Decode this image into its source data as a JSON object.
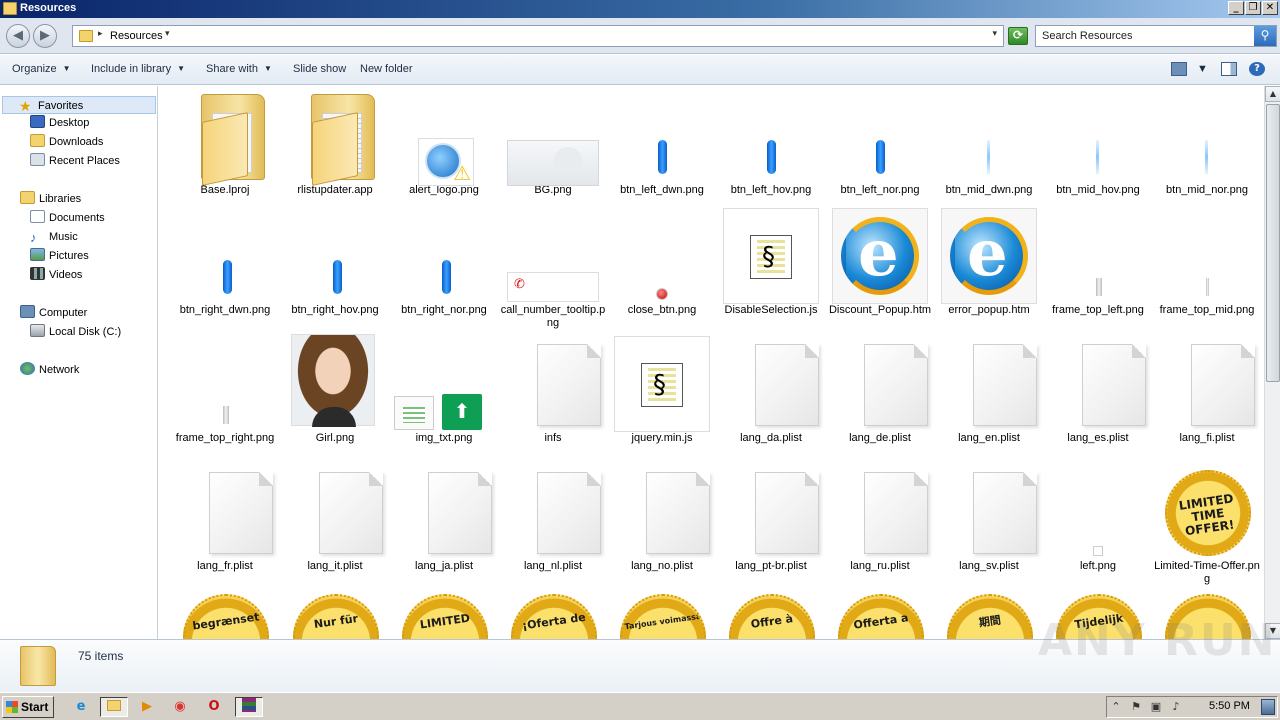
{
  "window": {
    "title": "Resources"
  },
  "address": {
    "crumb": "Resources",
    "search_placeholder": "Search Resources"
  },
  "toolbar": {
    "organize": "Organize",
    "include_in_library": "Include in library",
    "share_with": "Share with",
    "slide_show": "Slide show",
    "new_folder": "New folder"
  },
  "nav": {
    "favorites": "Favorites",
    "desktop": "Desktop",
    "downloads": "Downloads",
    "recent_places": "Recent Places",
    "libraries": "Libraries",
    "documents": "Documents",
    "music": "Music",
    "pictures": "Pictures",
    "videos": "Videos",
    "computer": "Computer",
    "local_disk": "Local Disk (C:)",
    "network": "Network"
  },
  "files": [
    {
      "name": "Base.lproj",
      "icon": "folder-empty-icon"
    },
    {
      "name": "rlistupdater.app",
      "icon": "folder-with-files-icon"
    },
    {
      "name": "alert_logo.png",
      "icon": "alert-logo-thumbnail"
    },
    {
      "name": "BG.png",
      "icon": "bg-thumbnail"
    },
    {
      "name": "btn_left_dwn.png",
      "icon": "blue-pill-thumbnail"
    },
    {
      "name": "btn_left_hov.png",
      "icon": "blue-pill-thumbnail"
    },
    {
      "name": "btn_left_nor.png",
      "icon": "blue-pill-thumbnail"
    },
    {
      "name": "btn_mid_dwn.png",
      "icon": "thin-line-thumbnail"
    },
    {
      "name": "btn_mid_hov.png",
      "icon": "thin-line-thumbnail"
    },
    {
      "name": "btn_mid_nor.png",
      "icon": "thin-line-thumbnail"
    },
    {
      "name": "btn_right_dwn.png",
      "icon": "blue-pill-thumbnail"
    },
    {
      "name": "btn_right_hov.png",
      "icon": "blue-pill-thumbnail"
    },
    {
      "name": "btn_right_nor.png",
      "icon": "blue-pill-thumbnail"
    },
    {
      "name": "call_number_tooltip.png",
      "icon": "phone-tooltip-thumbnail"
    },
    {
      "name": "close_btn.png",
      "icon": "red-dot-thumbnail"
    },
    {
      "name": "DisableSelection.js",
      "icon": "script-icon"
    },
    {
      "name": "Discount_Popup.htm",
      "icon": "ie-icon"
    },
    {
      "name": "error_popup.htm",
      "icon": "ie-icon"
    },
    {
      "name": "frame_top_left.png",
      "icon": "gray-line-thumbnail"
    },
    {
      "name": "frame_top_mid.png",
      "icon": "gray-line-thumbnail"
    },
    {
      "name": "frame_top_right.png",
      "icon": "gray-line-thumbnail"
    },
    {
      "name": "Girl.png",
      "icon": "girl-photo-thumbnail"
    },
    {
      "name": "img_txt.png",
      "icon": "img-txt-thumbnail"
    },
    {
      "name": "infs",
      "icon": "blank-file-icon"
    },
    {
      "name": "jquery.min.js",
      "icon": "script-icon"
    },
    {
      "name": "lang_da.plist",
      "icon": "blank-file-icon"
    },
    {
      "name": "lang_de.plist",
      "icon": "blank-file-icon"
    },
    {
      "name": "lang_en.plist",
      "icon": "blank-file-icon"
    },
    {
      "name": "lang_es.plist",
      "icon": "blank-file-icon"
    },
    {
      "name": "lang_fi.plist",
      "icon": "blank-file-icon"
    },
    {
      "name": "lang_fr.plist",
      "icon": "blank-file-icon"
    },
    {
      "name": "lang_it.plist",
      "icon": "blank-file-icon"
    },
    {
      "name": "lang_ja.plist",
      "icon": "blank-file-icon"
    },
    {
      "name": "lang_nl.plist",
      "icon": "blank-file-icon"
    },
    {
      "name": "lang_no.plist",
      "icon": "blank-file-icon"
    },
    {
      "name": "lang_pt-br.plist",
      "icon": "blank-file-icon"
    },
    {
      "name": "lang_ru.plist",
      "icon": "blank-file-icon"
    },
    {
      "name": "lang_sv.plist",
      "icon": "blank-file-icon"
    },
    {
      "name": "left.png",
      "icon": "tiny-image-thumbnail"
    },
    {
      "name": "Limited-Time-Offer.png",
      "icon": "offer-badge-thumbnail",
      "badge_text": "LIMITED TIME OFFER!"
    }
  ],
  "partial_badges": [
    "begrænset",
    "Nur für",
    "LIMITED",
    "¡Oferta de",
    "Tarjous voimassa",
    "Offre à",
    "Offerta a",
    "期間",
    "Tijdelijk",
    ""
  ],
  "status": {
    "item_count": "75 items"
  },
  "watermark": "ANY RUN",
  "taskbar": {
    "start": "Start",
    "clock": "5:50 PM"
  },
  "colors": {
    "title_bar": "#0a246a",
    "selection": "#dde9f6",
    "badge": "#f5d25a"
  }
}
